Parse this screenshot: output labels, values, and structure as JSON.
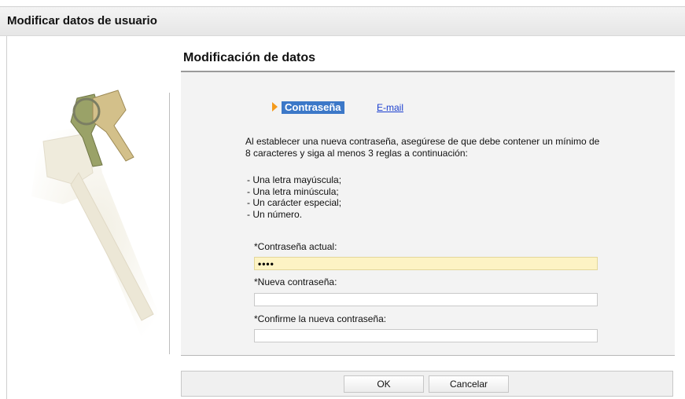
{
  "header": {
    "title": "Modificar datos de usuario"
  },
  "section": {
    "title": "Modificación de datos"
  },
  "tabs": {
    "active_label": "Contraseña",
    "link_label": "E-mail"
  },
  "description": "Al establecer una nueva contraseña, asegúrese de que debe contener un mínimo de 8 caracteres y siga al menos 3 reglas a continuación:",
  "rules": [
    "- Una letra mayúscula;",
    "- Una letra minúscula;",
    "- Un carácter especial;",
    "- Un número."
  ],
  "fields": {
    "current": {
      "label": "*Contraseña actual:",
      "value": "••••"
    },
    "new": {
      "label": "*Nueva contraseña:",
      "value": ""
    },
    "confirm": {
      "label": "*Confirme la nueva contraseña:",
      "value": ""
    }
  },
  "buttons": {
    "ok": "OK",
    "cancel": "Cancelar"
  },
  "colors": {
    "accent": "#3c78c8",
    "arrow": "#f49a1b",
    "link": "#1b3fcf",
    "input_highlight": "#fdf3c4"
  },
  "icons": {
    "arrow": "triangle-right-icon",
    "illustration": "keys-illustration"
  }
}
